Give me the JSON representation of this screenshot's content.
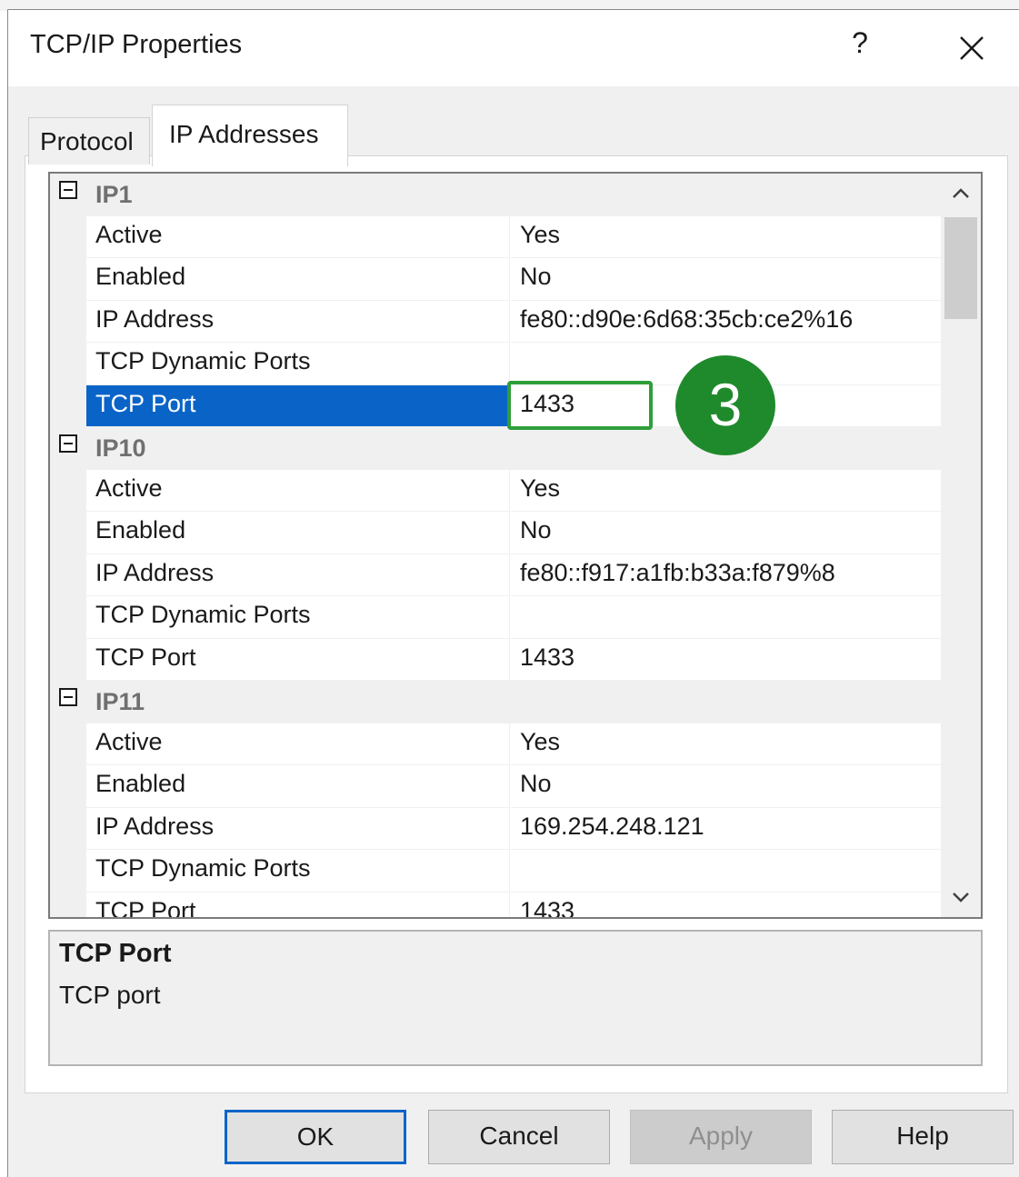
{
  "window": {
    "title": "TCP/IP Properties",
    "help_glyph": "?"
  },
  "tabs": [
    {
      "label": "Protocol"
    },
    {
      "label": "IP Addresses"
    }
  ],
  "groups": [
    {
      "name": "IP1",
      "rows": [
        {
          "name": "Active",
          "value": "Yes"
        },
        {
          "name": "Enabled",
          "value": "No"
        },
        {
          "name": "IP Address",
          "value": "fe80::d90e:6d68:35cb:ce2%16"
        },
        {
          "name": "TCP Dynamic Ports",
          "value": ""
        },
        {
          "name": "TCP Port",
          "value": "1433"
        }
      ]
    },
    {
      "name": "IP10",
      "rows": [
        {
          "name": "Active",
          "value": "Yes"
        },
        {
          "name": "Enabled",
          "value": "No"
        },
        {
          "name": "IP Address",
          "value": "fe80::f917:a1fb:b33a:f879%8"
        },
        {
          "name": "TCP Dynamic Ports",
          "value": ""
        },
        {
          "name": "TCP Port",
          "value": "1433"
        }
      ]
    },
    {
      "name": "IP11",
      "rows": [
        {
          "name": "Active",
          "value": "Yes"
        },
        {
          "name": "Enabled",
          "value": "No"
        },
        {
          "name": "IP Address",
          "value": "169.254.248.121"
        },
        {
          "name": "TCP Dynamic Ports",
          "value": ""
        },
        {
          "name": "TCP Port",
          "value": "1433"
        }
      ]
    }
  ],
  "annotation": {
    "step": "3"
  },
  "description": {
    "title": "TCP Port",
    "text": "TCP port"
  },
  "buttons": {
    "ok": "OK",
    "cancel": "Cancel",
    "apply": "Apply",
    "help": "Help"
  },
  "colors": {
    "selection": "#0a64c8",
    "annotation": "#1f8a2c"
  }
}
